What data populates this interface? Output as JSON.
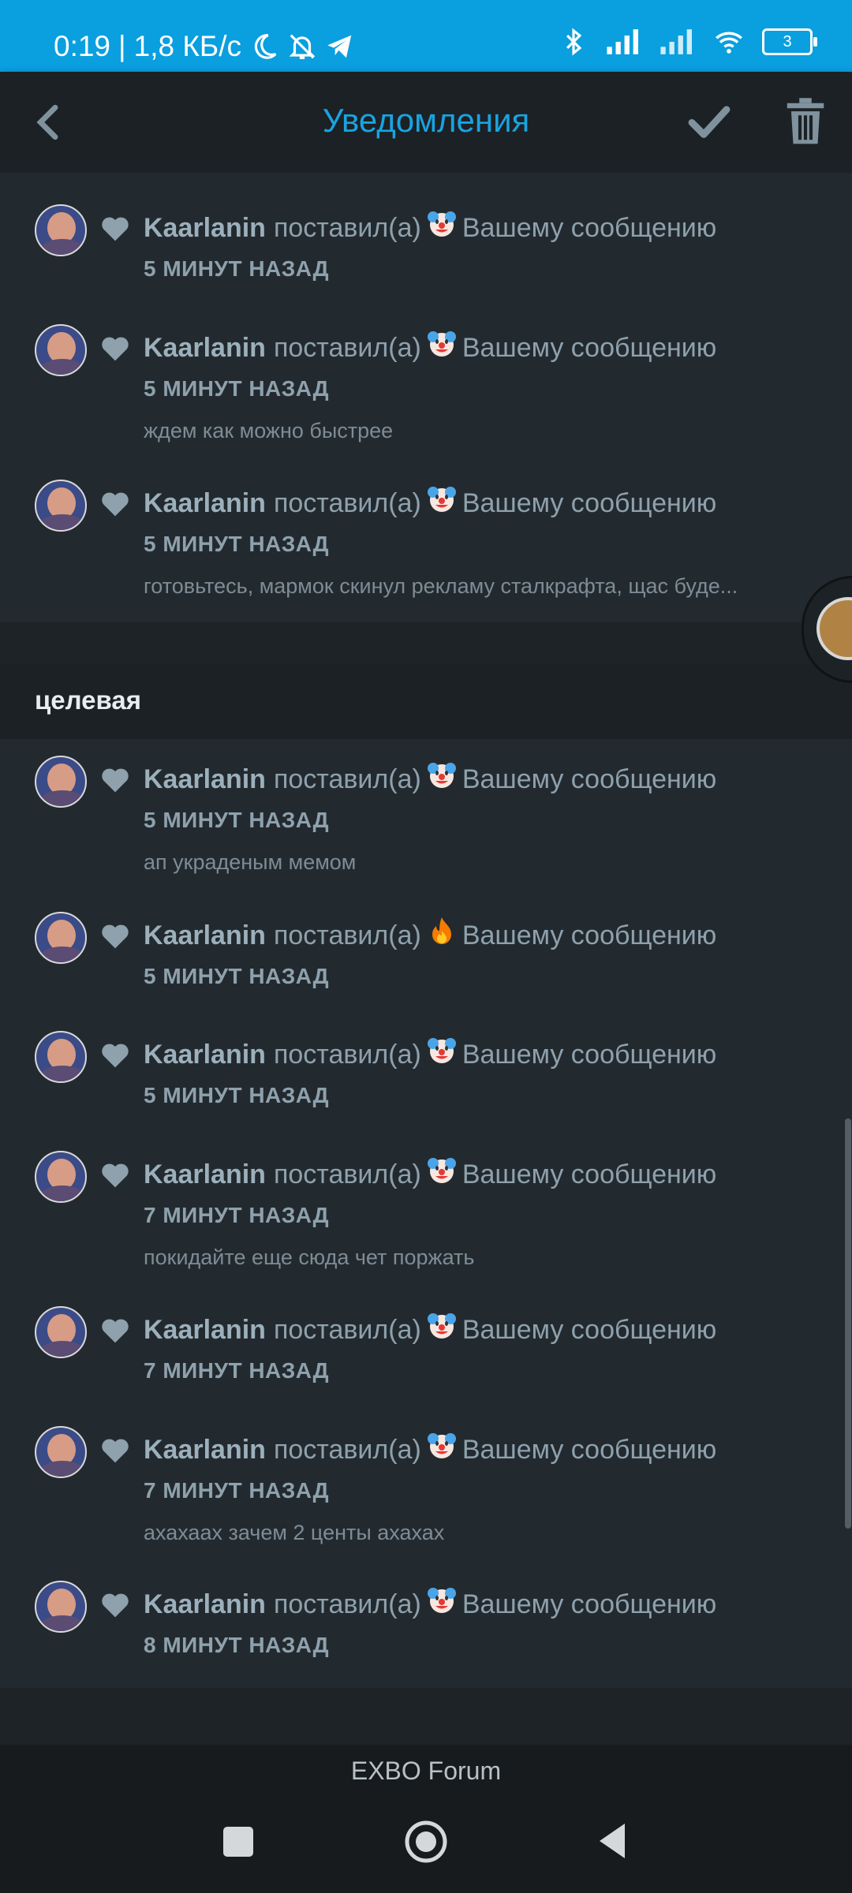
{
  "status_bar": {
    "time": "0:19",
    "separator": "|",
    "speed": "1,8 КБ/с",
    "battery": "3"
  },
  "app_bar": {
    "title": "Уведомления",
    "accent_color": "#1aa3e0"
  },
  "notifications_top": [
    {
      "user": "Kaarlanin",
      "action": "поставил(а)",
      "emoji": "clown",
      "target": "Вашему сообщению",
      "time": "5 МИНУТ НАЗАД",
      "excerpt": ""
    },
    {
      "user": "Kaarlanin",
      "action": "поставил(а)",
      "emoji": "clown",
      "target": "Вашему сообщению",
      "time": "5 МИНУТ НАЗАД",
      "excerpt": "ждем как можно быстрее"
    },
    {
      "user": "Kaarlanin",
      "action": "поставил(а)",
      "emoji": "clown",
      "target": "Вашему сообщению",
      "time": "5 МИНУТ НАЗАД",
      "excerpt": "готовьтесь, мармок скинул рекламу сталкрафта, щас буде..."
    }
  ],
  "group": {
    "title": "целевая",
    "items": [
      {
        "user": "Kaarlanin",
        "action": "поставил(а)",
        "emoji": "clown",
        "target": "Вашему сообщению",
        "time": "5 МИНУТ НАЗАД",
        "excerpt": "ап украденым мемом"
      },
      {
        "user": "Kaarlanin",
        "action": "поставил(а)",
        "emoji": "fire",
        "target": "Вашему сообщению",
        "time": "5 МИНУТ НАЗАД",
        "excerpt": ""
      },
      {
        "user": "Kaarlanin",
        "action": "поставил(а)",
        "emoji": "clown",
        "target": "Вашему сообщению",
        "time": "5 МИНУТ НАЗАД",
        "excerpt": ""
      },
      {
        "user": "Kaarlanin",
        "action": "поставил(а)",
        "emoji": "clown",
        "target": "Вашему сообщению",
        "time": "7 МИНУТ НАЗАД",
        "excerpt": "покидайте еще сюда чет поржать"
      },
      {
        "user": "Kaarlanin",
        "action": "поставил(а)",
        "emoji": "clown",
        "target": "Вашему сообщению",
        "time": "7 МИНУТ НАЗАД",
        "excerpt": ""
      },
      {
        "user": "Kaarlanin",
        "action": "поставил(а)",
        "emoji": "clown",
        "target": "Вашему сообщению",
        "time": "7 МИНУТ НАЗАД",
        "excerpt": "ахахаах зачем 2 центы ахахах"
      },
      {
        "user": "Kaarlanin",
        "action": "поставил(а)",
        "emoji": "clown",
        "target": "Вашему сообщению",
        "time": "8 МИНУТ НАЗАД",
        "excerpt": ""
      }
    ]
  },
  "footer": {
    "caption": "EXBO Forum"
  }
}
